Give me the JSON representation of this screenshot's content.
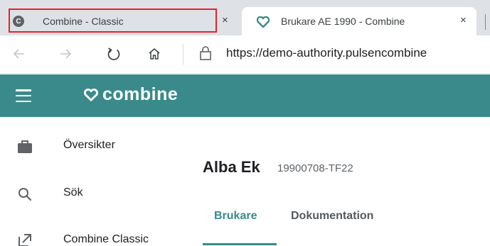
{
  "browser": {
    "tabs": [
      {
        "title": "Combine - Classic",
        "favicon_letter": "C",
        "close": "×",
        "active": false,
        "highlighted": true
      },
      {
        "title": "Brukare AE 1990 - Combine",
        "close": "×",
        "active": true
      }
    ],
    "url": "https://demo-authority.pulsencombine",
    "icons": {
      "back": "arrow-left-icon",
      "forward": "arrow-right-icon",
      "reload": "reload-icon",
      "home": "home-icon",
      "lock": "lock-icon"
    }
  },
  "app": {
    "brand": "combine",
    "brand_color": "#3a8a8c",
    "menu_icon": "hamburger-icon"
  },
  "sidebar": {
    "items": [
      {
        "label": "Översikter",
        "icon": "briefcase-icon"
      },
      {
        "label": "Sök",
        "icon": "search-icon"
      },
      {
        "label": "Combine Classic",
        "icon": "open-external-icon"
      }
    ]
  },
  "person": {
    "name": "Alba Ek",
    "id": "19900708-TF22"
  },
  "content_tabs": [
    {
      "label": "Brukare",
      "active": true
    },
    {
      "label": "Dokumentation",
      "active": false
    }
  ]
}
